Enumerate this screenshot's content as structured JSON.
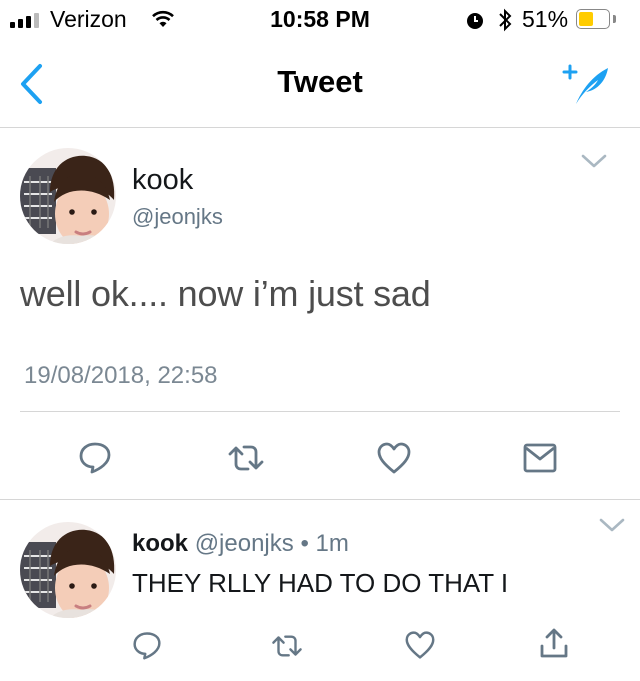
{
  "status_bar": {
    "carrier": "Verizon",
    "time": "10:58 PM",
    "battery_percent_label": "51%",
    "battery_level": 0.51,
    "battery_color": "#ffcc00"
  },
  "nav": {
    "title": "Tweet",
    "back_icon": "chevron-left-icon",
    "compose_icon": "compose-tweet-icon"
  },
  "colors": {
    "accent": "#1da1f2",
    "icon_gray": "#657786",
    "divider": "#d6d6d6"
  },
  "main_tweet": {
    "author_name": "kook",
    "author_handle": "@jeonjks",
    "text": "well ok.... now i’m just sad",
    "timestamp": "19/08/2018, 22:58",
    "actions": [
      "reply-icon",
      "retweet-icon",
      "like-icon",
      "message-icon"
    ]
  },
  "reply_tweet": {
    "author_name": "kook",
    "author_handle": "@jeonjks",
    "separator": "•",
    "age": "1m",
    "text": "THEY RLLY HAD TO DO THAT I",
    "actions": [
      "reply-icon",
      "retweet-icon",
      "like-icon",
      "share-icon"
    ]
  }
}
